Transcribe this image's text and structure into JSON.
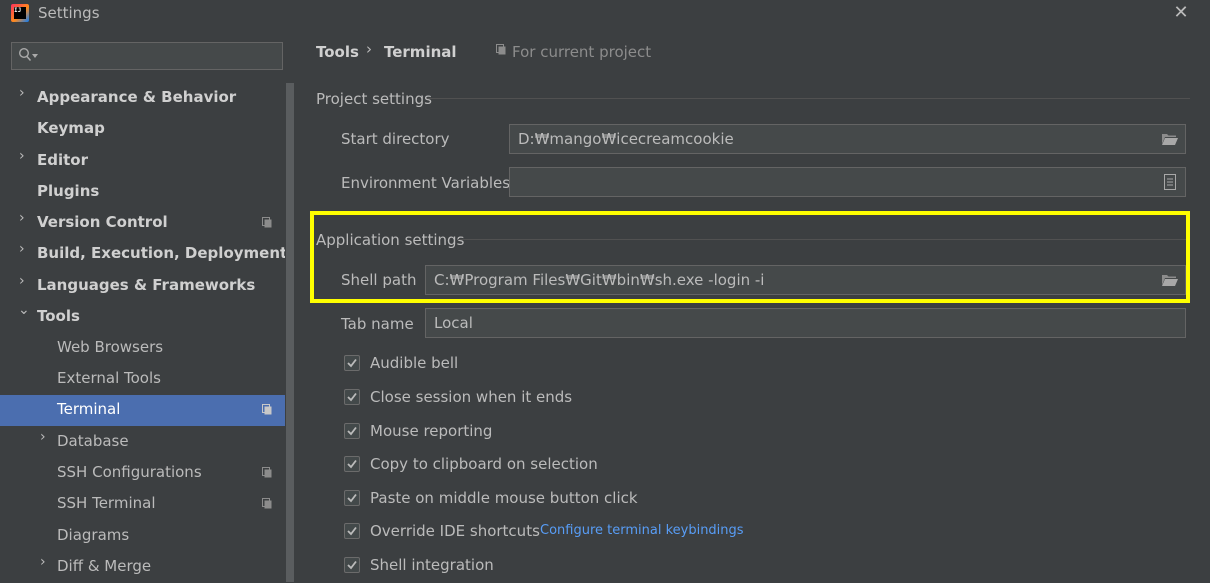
{
  "window": {
    "title": "Settings",
    "logo_text": "IJ"
  },
  "sidebar": {
    "search_placeholder": "",
    "items": [
      {
        "label": "Appearance & Behavior",
        "chevron": "›",
        "bold": true
      },
      {
        "label": "Keymap",
        "bold": true
      },
      {
        "label": "Editor",
        "chevron": "›",
        "bold": true
      },
      {
        "label": "Plugins",
        "bold": true
      },
      {
        "label": "Version Control",
        "chevron": "›",
        "bold": true,
        "project_scoped": true
      },
      {
        "label": "Build, Execution, Deployment",
        "chevron": "›",
        "bold": true
      },
      {
        "label": "Languages & Frameworks",
        "chevron": "›",
        "bold": true
      },
      {
        "label": "Tools",
        "chevron": "⌄",
        "bold": true
      },
      {
        "label": "Web Browsers"
      },
      {
        "label": "External Tools"
      },
      {
        "label": "Terminal",
        "selected": true,
        "project_scoped": true
      },
      {
        "label": "Database",
        "chevron": "›"
      },
      {
        "label": "SSH Configurations",
        "project_scoped": true
      },
      {
        "label": "SSH Terminal",
        "project_scoped": true
      },
      {
        "label": "Diagrams"
      },
      {
        "label": "Diff & Merge",
        "chevron": "›"
      }
    ]
  },
  "breadcrumb": {
    "parent": "Tools",
    "separator": "›",
    "current": "Terminal",
    "scope": "For current project"
  },
  "project_settings": {
    "title": "Project settings",
    "start_directory": {
      "label": "Start directory",
      "value": "D:₩mango₩icecreamcookie"
    },
    "environment_variables": {
      "label": "Environment Variables",
      "value": ""
    }
  },
  "application_settings": {
    "title": "Application settings",
    "shell_path": {
      "label": "Shell path",
      "value": "C:₩Program Files₩Git₩bin₩sh.exe -login -i"
    },
    "tab_name": {
      "label": "Tab name",
      "value": "Local"
    },
    "checkboxes": [
      {
        "label": "Audible bell",
        "checked": true
      },
      {
        "label": "Close session when it ends",
        "checked": true
      },
      {
        "label": "Mouse reporting",
        "checked": true
      },
      {
        "label": "Copy to clipboard on selection",
        "checked": true
      },
      {
        "label": "Paste on middle mouse button click",
        "checked": true
      },
      {
        "label": "Override IDE shortcuts",
        "checked": true
      },
      {
        "label": "Shell integration",
        "checked": true
      }
    ],
    "configure_link": "Configure terminal keybindings"
  },
  "colors": {
    "background": "#3c3f41",
    "selection": "#4b6eaf",
    "link": "#589df6",
    "highlight": "#ffff00"
  },
  "icons": {
    "close": "close-icon",
    "search": "search-icon",
    "folder": "folder-icon",
    "project": "project-scope-icon"
  }
}
